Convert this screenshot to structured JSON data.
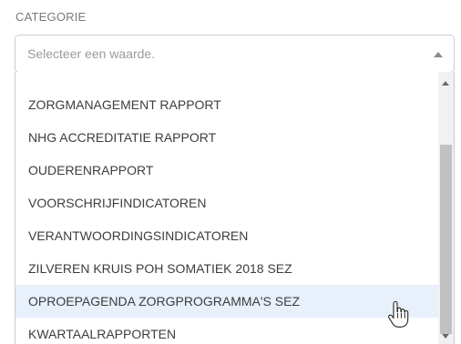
{
  "field": {
    "label": "CATEGORIE",
    "placeholder": "Selecteer een waarde."
  },
  "dropdown": {
    "options": [
      "ZORGMANAGEMENT RAPPORT",
      "NHG ACCREDITATIE RAPPORT",
      "OUDERENRAPPORT",
      "VOORSCHRIJFINDICATOREN",
      "VERANTWOORDINGSINDICATOREN",
      "ZILVEREN KRUIS POH SOMATIEK 2018 SEZ",
      "OPROEPAGENDA ZORGPROGRAMMA'S SEZ",
      "KWARTAALRAPPORTEN"
    ],
    "hovered_option": "OPROEPAGENDA ZORGPROGRAMMA'S SEZ"
  },
  "colors": {
    "hover_highlight": "#e8f0fb",
    "border": "#c9ccd1",
    "text": "#3d3d3d",
    "placeholder": "#9b9b9b"
  },
  "icons": {
    "select_arrow": "caret-up-icon",
    "scroll_up": "scroll-up-arrow-icon",
    "scroll_down": "scroll-down-arrow-icon",
    "cursor": "hand-pointer-cursor-icon"
  }
}
